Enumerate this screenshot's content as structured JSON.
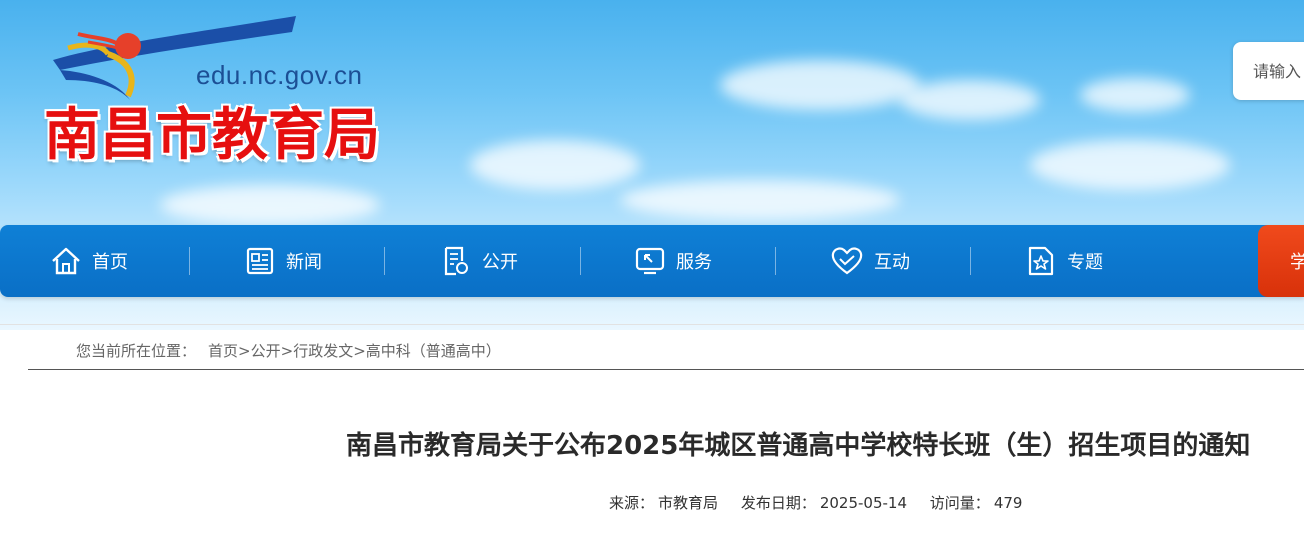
{
  "header": {
    "domain": "edu.nc.gov.cn",
    "org_name": "南昌市教育局",
    "search_placeholder": "请输入"
  },
  "nav": {
    "items": [
      {
        "label": "首页",
        "icon": "home-icon"
      },
      {
        "label": "新闻",
        "icon": "newspaper-icon"
      },
      {
        "label": "公开",
        "icon": "document-icon"
      },
      {
        "label": "服务",
        "icon": "service-screen-icon"
      },
      {
        "label": "互动",
        "icon": "heart-icon"
      },
      {
        "label": "专题",
        "icon": "star-page-icon"
      }
    ],
    "extra_label": "学"
  },
  "breadcrumb": {
    "prefix": "您当前所在位置：",
    "items": [
      "首页",
      "公开",
      "行政发文",
      "高中科（普通高中）"
    ],
    "separator": ">"
  },
  "article": {
    "title": "南昌市教育局关于公布2025年城区普通高中学校特长班（生）招生项目的通知",
    "source_label": "来源：",
    "source": "市教育局",
    "date_label": "发布日期：",
    "date": "2025-05-14",
    "views_label": "访问量：",
    "views": "479"
  },
  "colors": {
    "nav_blue": "#0a6fc6",
    "title_red": "#e60f0f",
    "extra_orange": "#e2400f"
  }
}
